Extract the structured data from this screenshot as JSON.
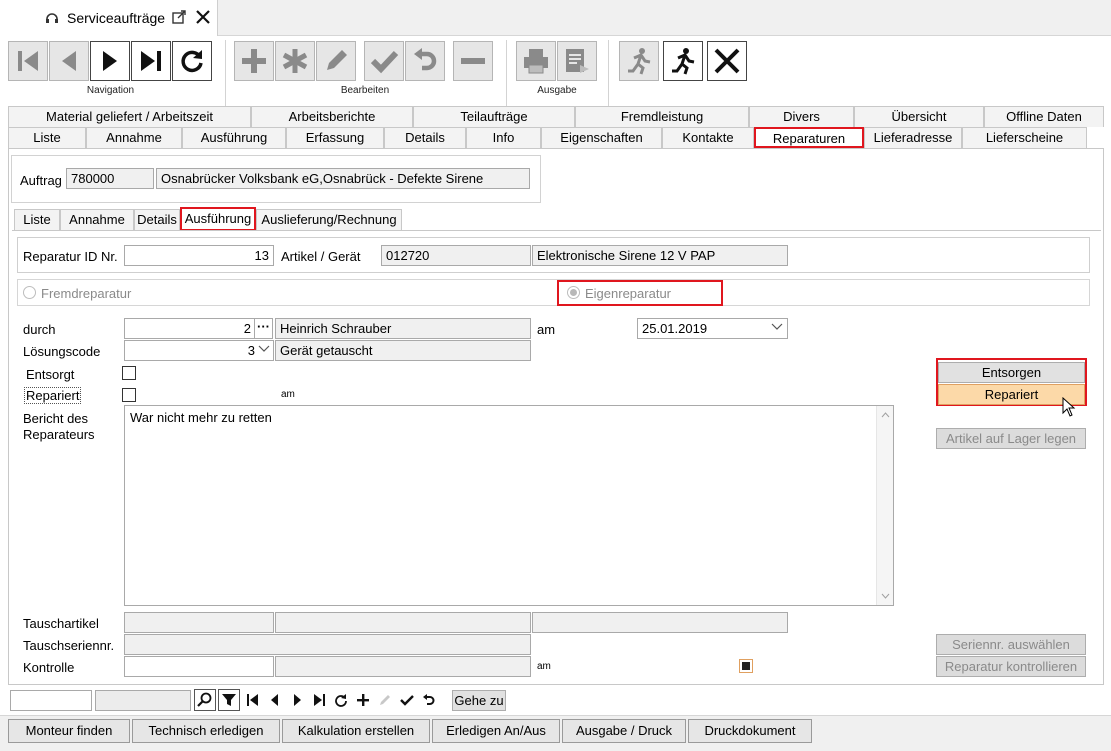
{
  "doc_tab": {
    "title": "Serviceaufträge"
  },
  "toolbar": {
    "navigation_label": "Navigation",
    "bearbeiten_label": "Bearbeiten",
    "ausgabe_label": "Ausgabe"
  },
  "tabs_row1": [
    "Material geliefert / Arbeitszeit",
    "Arbeitsberichte",
    "Teilaufträge",
    "Fremdleistung",
    "Divers",
    "Übersicht",
    "Offline Daten"
  ],
  "tabs_row2": [
    "Liste",
    "Annahme",
    "Ausführung",
    "Erfassung",
    "Details",
    "Info",
    "Eigenschaften",
    "Kontakte",
    "Reparaturen",
    "Lieferadresse",
    "Lieferscheine"
  ],
  "active_tab_row2": "Reparaturen",
  "auftrag": {
    "label": "Auftrag",
    "number": "780000",
    "description": "Osnabrücker Volksbank eG,Osnabrück - Defekte Sirene"
  },
  "subtabs": [
    "Liste",
    "Annahme",
    "Details",
    "Ausführung",
    "Auslieferung/Rechnung"
  ],
  "active_subtab": "Ausführung",
  "reparatur": {
    "id_label": "Reparatur ID Nr.",
    "id_value": "13",
    "artikel_label": "Artikel / Gerät",
    "artikel_nr": "012720",
    "artikel_name": "Elektronische Sirene 12 V PAP"
  },
  "radio": {
    "fremd": "Fremdreparatur",
    "eigen": "Eigenreparatur",
    "selected": "Eigenreparatur"
  },
  "form": {
    "durch_label": "durch",
    "durch_value": "2",
    "durch_name": "Heinrich Schrauber",
    "am_label": "am",
    "am_date": "25.01.2019",
    "loesung_label": "Lösungscode",
    "loesung_value": "3",
    "loesung_text": "Gerät getauscht",
    "entsorgt_label": "Entsorgt",
    "repariert_label": "Repariert",
    "repariert_am": "am",
    "bericht_label_1": "Bericht des",
    "bericht_label_2": "Reparateurs",
    "bericht_text": "War nicht mehr zu retten",
    "tausch_label": "Tauschartikel",
    "tauschserien_label": "Tauschseriennr.",
    "kontrolle_label": "Kontrolle",
    "kontrolle_am": "am"
  },
  "side_buttons": {
    "entsorgen": "Entsorgen",
    "repariert": "Repariert",
    "lager": "Artikel auf Lager legen",
    "seriennr": "Seriennr. auswählen",
    "kontrollieren": "Reparatur kontrollieren"
  },
  "navbar": {
    "gehe_zu": "Gehe zu"
  },
  "bottom_buttons": [
    "Monteur finden",
    "Technisch erledigen",
    "Kalkulation erstellen",
    "Erledigen An/Aus",
    "Ausgabe / Druck",
    "Druckdokument"
  ],
  "colors": {
    "highlight_red": "#e0161e",
    "repariert_btn": "#fcd9a8"
  }
}
